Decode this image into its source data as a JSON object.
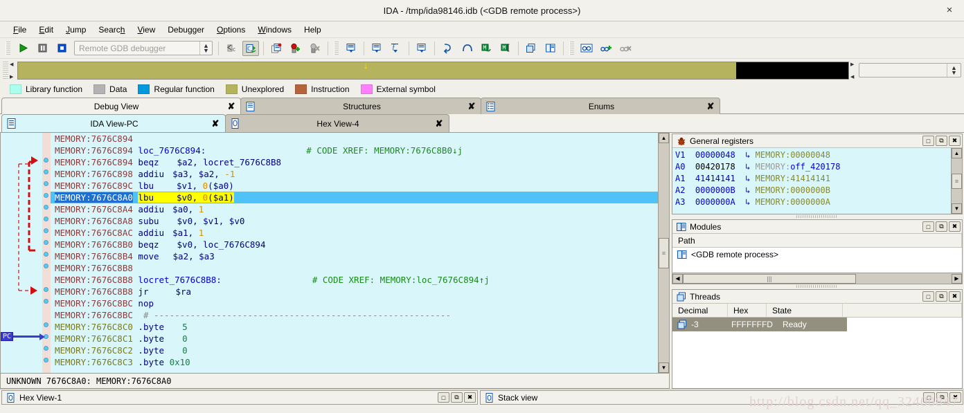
{
  "window": {
    "title": "IDA - /tmp/ida98146.idb (<GDB remote process>)",
    "close_glyph": "×"
  },
  "menubar": {
    "items": [
      {
        "label": "File",
        "accel": "F"
      },
      {
        "label": "Edit",
        "accel": "E"
      },
      {
        "label": "Jump",
        "accel": "J"
      },
      {
        "label": "Search",
        "accel": "h"
      },
      {
        "label": "View",
        "accel": "V"
      },
      {
        "label": "Debugger",
        "accel": "g"
      },
      {
        "label": "Options",
        "accel": "O"
      },
      {
        "label": "Windows",
        "accel": "W"
      },
      {
        "label": "Help",
        "accel": "H"
      }
    ]
  },
  "toolbar": {
    "run_label": "Run",
    "pause_label": "Pause",
    "stop_label": "Terminate process",
    "debugger_select": {
      "value": "",
      "placeholder": "Remote GDB debugger"
    },
    "step_into_label": "Step into",
    "step_over_label": "Step over",
    "run_to_cursor_label": "Run to cursor",
    "breakpoint_label": "Add breakpoint",
    "delete_breakpoint_label": "Delete breakpoint"
  },
  "navband": {
    "cursor_glyph": "↓",
    "unexplored_pct": 86.5,
    "address_combo_value": ""
  },
  "legend": {
    "items": [
      {
        "label": "Library function",
        "color": "#aaffee"
      },
      {
        "label": "Data",
        "color": "#b3b3b3"
      },
      {
        "label": "Regular function",
        "color": "#0099dd"
      },
      {
        "label": "Unexplored",
        "color": "#b5b35e"
      },
      {
        "label": "Instruction",
        "color": "#b4643c"
      },
      {
        "label": "External symbol",
        "color": "#ff80ff"
      }
    ]
  },
  "outer_tabs": [
    {
      "label": "Debug View",
      "selected": true,
      "icon": "",
      "close": "✘"
    },
    {
      "label": "Structures",
      "selected": false,
      "icon": "struct-icon",
      "close": "✘"
    },
    {
      "label": "Enums",
      "selected": false,
      "icon": "enum-icon",
      "close": "✘"
    }
  ],
  "inner_tabs": [
    {
      "label": "IDA View-PC",
      "selected": true,
      "icon": "ida-view-icon",
      "close": "✘"
    },
    {
      "label": "Hex View-4",
      "selected": false,
      "icon": "hex-view-icon",
      "close": "✘"
    }
  ],
  "disassembly": {
    "lines": [
      {
        "addr": "MEMORY:7676C894",
        "text": "",
        "kind": "blank",
        "dot": false
      },
      {
        "addr": "MEMORY:7676C894",
        "label": "loc_7676C894:",
        "comment": "# CODE XREF: MEMORY:7676C8B0↓j",
        "kind": "label",
        "dot": false
      },
      {
        "addr": "MEMORY:7676C894",
        "mnemonic": "beqz",
        "operands": "$a2, locret_7676C8B8",
        "kind": "insn",
        "dot": true
      },
      {
        "addr": "MEMORY:7676C898",
        "mnemonic": "addiu",
        "operands": "$a3, $a2, -1",
        "kind": "insn",
        "dot": true
      },
      {
        "addr": "MEMORY:7676C89C",
        "mnemonic": "lbu",
        "operands": "$v1, 0($a0)",
        "kind": "insn",
        "dot": true
      },
      {
        "addr": "MEMORY:7676C8A0",
        "mnemonic": "lbu",
        "operands": "$v0, 0($a1)",
        "kind": "insn",
        "dot": true,
        "current": true
      },
      {
        "addr": "MEMORY:7676C8A4",
        "mnemonic": "addiu",
        "operands": "$a0, 1",
        "kind": "insn",
        "dot": true
      },
      {
        "addr": "MEMORY:7676C8A8",
        "mnemonic": "subu",
        "operands": "$v0, $v1, $v0",
        "kind": "insn",
        "dot": true
      },
      {
        "addr": "MEMORY:7676C8AC",
        "mnemonic": "addiu",
        "operands": "$a1, 1",
        "kind": "insn",
        "dot": true
      },
      {
        "addr": "MEMORY:7676C8B0",
        "mnemonic": "beqz",
        "operands": "$v0, loc_7676C894",
        "kind": "insn",
        "dot": true
      },
      {
        "addr": "MEMORY:7676C8B4",
        "mnemonic": "move",
        "operands": "$a2, $a3",
        "kind": "insn",
        "dot": true
      },
      {
        "addr": "MEMORY:7676C8B8",
        "text": "",
        "kind": "blank",
        "dot": false
      },
      {
        "addr": "MEMORY:7676C8B8",
        "label": "locret_7676C8B8:",
        "comment": "# CODE XREF: MEMORY:loc_7676C894↑j",
        "kind": "label",
        "dot": false
      },
      {
        "addr": "MEMORY:7676C8B8",
        "mnemonic": "jr",
        "operands": "$ra",
        "kind": "insn",
        "dot": true
      },
      {
        "addr": "MEMORY:7676C8BC",
        "mnemonic": "nop",
        "operands": "",
        "kind": "insn",
        "dot": true
      },
      {
        "addr": "MEMORY:7676C8BC",
        "separator": "# ---------------------------------------------------------",
        "kind": "sep",
        "dot": false
      },
      {
        "addr": "MEMORY:7676C8C0",
        "directive": ".byte",
        "value": "5",
        "kind": "data",
        "dot": true
      },
      {
        "addr": "MEMORY:7676C8C1",
        "directive": ".byte",
        "value": "0",
        "kind": "data",
        "dot": true
      },
      {
        "addr": "MEMORY:7676C8C2",
        "directive": ".byte",
        "value": "0",
        "kind": "data",
        "dot": true
      },
      {
        "addr": "MEMORY:7676C8C3",
        "directive": ".byte",
        "value": "0x10",
        "kind": "data",
        "dot": true
      }
    ],
    "pc_label": "PC",
    "status": "UNKNOWN 7676C8A0: MEMORY:7676C8A0"
  },
  "registers_panel": {
    "title": "General registers",
    "rows": [
      {
        "name": "V1",
        "value": "00000048",
        "value_color": "blue",
        "arrow": "↳",
        "mem_prefix": "MEMORY:",
        "mem_prefix_color": "olive",
        "target": "00000048",
        "target_color": "olive"
      },
      {
        "name": "A0",
        "value": "00420178",
        "value_color": "black",
        "arrow": "↳",
        "mem_prefix": "MEMORY:",
        "mem_prefix_color": "gray",
        "target": "off_420178",
        "target_color": "blue"
      },
      {
        "name": "A1",
        "value": "41414141",
        "value_color": "blue",
        "arrow": "↳",
        "mem_prefix": "MEMORY:",
        "mem_prefix_color": "olive",
        "target": "41414141",
        "target_color": "olive"
      },
      {
        "name": "A2",
        "value": "0000000B",
        "value_color": "blue",
        "arrow": "↳",
        "mem_prefix": "MEMORY:",
        "mem_prefix_color": "olive",
        "target": "0000000B",
        "target_color": "olive"
      },
      {
        "name": "A3",
        "value": "0000000A",
        "value_color": "blue",
        "arrow": "↳",
        "mem_prefix": "MEMORY:",
        "mem_prefix_color": "olive",
        "target": "0000000A",
        "target_color": "olive"
      }
    ]
  },
  "modules_panel": {
    "title": "Modules",
    "columns": [
      "Path"
    ],
    "rows": [
      {
        "path": "<GDB remote process>"
      }
    ]
  },
  "threads_panel": {
    "title": "Threads",
    "columns": [
      "Decimal",
      "Hex",
      "State"
    ],
    "rows": [
      {
        "decimal": "-3",
        "hex": "FFFFFFFD",
        "state": "Ready",
        "selected": true
      }
    ]
  },
  "bottom_bar": {
    "tabs": [
      {
        "label": "Hex View-1",
        "has_buttons": true
      },
      {
        "label": "Stack view",
        "has_buttons": false
      }
    ]
  },
  "window_buttons": {
    "restore": "□",
    "float": "⧉",
    "close": "✖"
  },
  "watermark": "http://blog.csdn.net/qq_32400847"
}
